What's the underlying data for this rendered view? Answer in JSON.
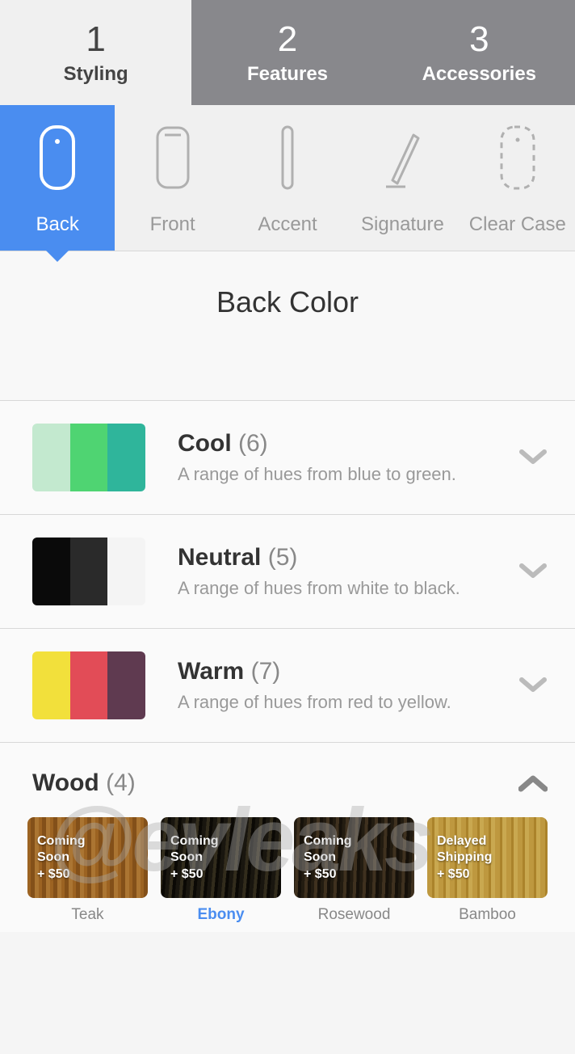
{
  "steps": [
    {
      "num": "1",
      "label": "Styling"
    },
    {
      "num": "2",
      "label": "Features"
    },
    {
      "num": "3",
      "label": "Accessories"
    }
  ],
  "subtabs": [
    {
      "label": "Back"
    },
    {
      "label": "Front"
    },
    {
      "label": "Accent"
    },
    {
      "label": "Signature"
    },
    {
      "label": "Clear Case"
    }
  ],
  "section_title": "Back Color",
  "categories": [
    {
      "name": "Cool",
      "count": "(6)",
      "desc": "A range of hues from blue to green.",
      "colors": [
        "#c3e9cf",
        "#4fd472",
        "#2fb59b"
      ]
    },
    {
      "name": "Neutral",
      "count": "(5)",
      "desc": "A range of hues from white to black.",
      "colors": [
        "#0a0a0a",
        "#2a2a2a",
        "#f4f4f4"
      ]
    },
    {
      "name": "Warm",
      "count": "(7)",
      "desc": "A range of hues from red to yellow.",
      "colors": [
        "#f2e03b",
        "#e24c57",
        "#5f3a50"
      ]
    }
  ],
  "wood": {
    "title": "Wood",
    "count": "(4)",
    "items": [
      {
        "name": "Teak",
        "badge": "Coming\nSoon",
        "price": "+ $50"
      },
      {
        "name": "Ebony",
        "badge": "Coming\nSoon",
        "price": "+ $50"
      },
      {
        "name": "Rosewood",
        "badge": "Coming\nSoon",
        "price": "+ $50"
      },
      {
        "name": "Bamboo",
        "badge": "Delayed\nShipping",
        "price": "+ $50"
      }
    ]
  },
  "watermark": "@evleaks"
}
